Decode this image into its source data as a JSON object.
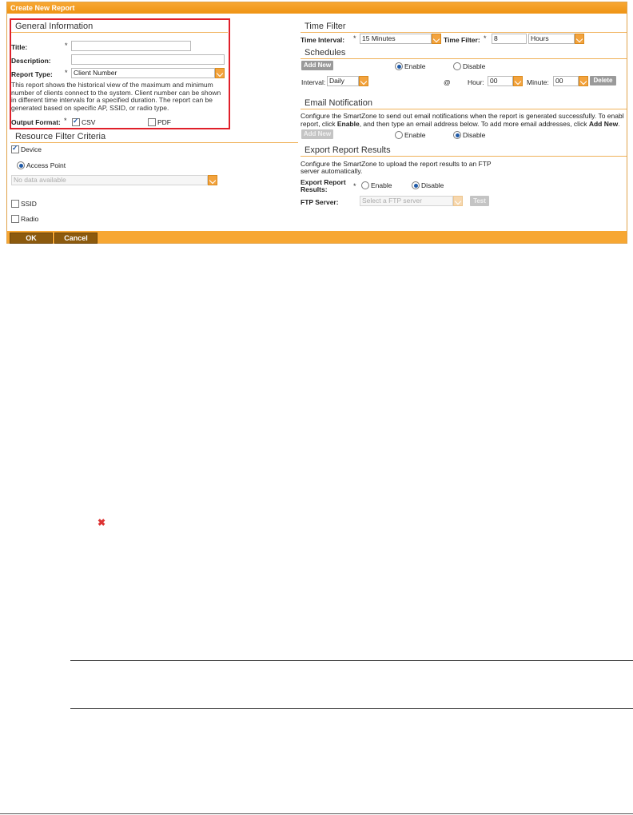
{
  "dialog": {
    "title": "Create New Report",
    "footer": {
      "ok_label": "OK",
      "cancel_label": "Cancel"
    }
  },
  "general": {
    "section_title": "General Information",
    "title_label": "Title:",
    "description_label": "Description:",
    "report_type_label": "Report Type:",
    "report_type_value": "Client Number",
    "description_lines": [
      "This report shows the historical view of the maximum and minimum",
      "number of clients connect to the system. Client number can be shown",
      "in different time intervals for a specified duration. The report can be",
      "generated based on specific AP, SSID, or radio type."
    ],
    "output_format_label": "Output Format:",
    "csv_label": "CSV",
    "csv_checked": true,
    "pdf_label": "PDF",
    "pdf_checked": false,
    "required_mark": "*"
  },
  "resource": {
    "section_title": "Resource Filter Criteria",
    "device_label": "Device",
    "device_checked": true,
    "access_point_label": "Access Point",
    "device_select_value": "No data available",
    "ssid_label": "SSID",
    "radio_label": "Radio"
  },
  "time_filter": {
    "section_title": "Time Filter",
    "interval_label": "Time Interval:",
    "interval_value": "15 Minutes",
    "filter_label": "Time Filter:",
    "filter_number": "8",
    "filter_unit": "Hours"
  },
  "schedules": {
    "section_title": "Schedules",
    "add_new_label": "Add New",
    "enable_label": "Enable",
    "disable_label": "Disable",
    "selected": "Enable",
    "interval_label": "Interval:",
    "interval_value": "Daily",
    "at_label": "@",
    "hour_label": "Hour:",
    "hour_value": "00",
    "minute_label": "Minute:",
    "minute_value": "00",
    "delete_label": "Delete"
  },
  "email": {
    "section_title": "Email Notification",
    "line1": "Configure the SmartZone to send out email notifications when the report is generated successfully. To enabl",
    "line2_pre": "report, click ",
    "line2_bold1": "Enable",
    "line2_mid": ", and then type an email address below. To add more email addresses, click ",
    "line2_bold2": "Add New",
    "line2_post": ".",
    "add_new_label": "Add New",
    "enable_label": "Enable",
    "disable_label": "Disable",
    "selected": "Disable"
  },
  "export": {
    "section_title": "Export Report Results",
    "desc_line1": "Configure the SmartZone to upload the report results to an FTP",
    "desc_line2": "server automatically.",
    "results_label_1": "Export Report",
    "results_label_2": "Results:",
    "enable_label": "Enable",
    "disable_label": "Disable",
    "selected": "Disable",
    "ftp_label": "FTP Server:",
    "ftp_placeholder": "Select a FTP server",
    "test_label": "Test"
  },
  "page_icons": {
    "close_icon": "close-icon"
  },
  "colors": {
    "accent": "#f7a733",
    "highlight_border": "#e0202a",
    "footer_button": "#8c5a0e"
  }
}
